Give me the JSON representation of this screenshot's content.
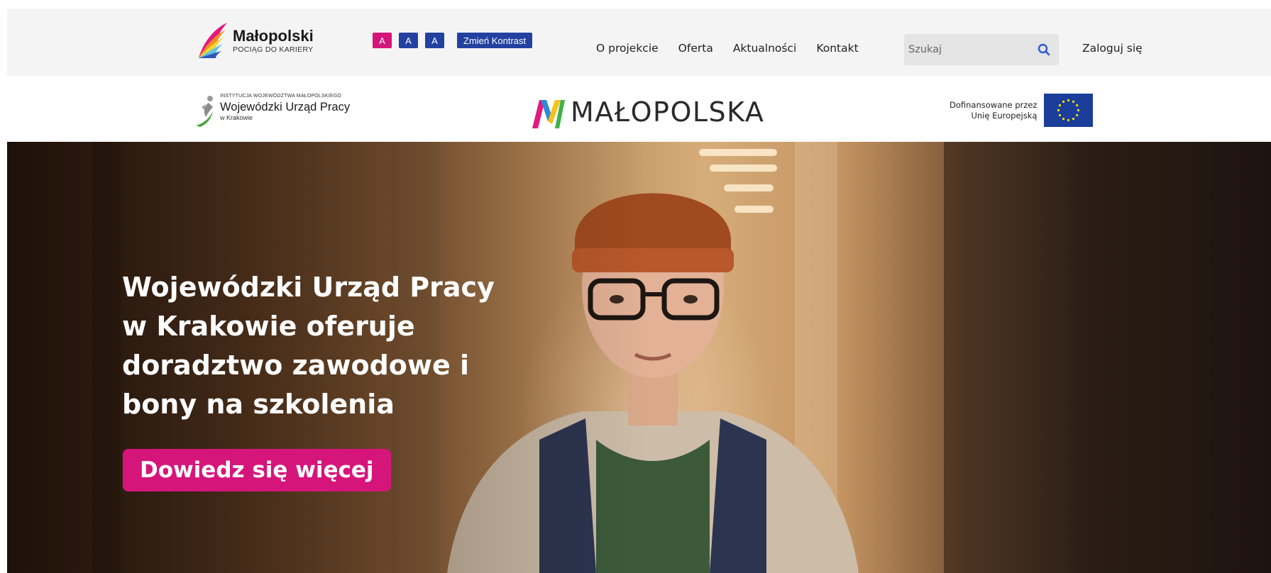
{
  "header": {
    "logo": {
      "title": "Małopolski",
      "subtitle": "POCIĄG DO KARIERY"
    },
    "font_size_buttons": [
      "A",
      "A",
      "A"
    ],
    "contrast_label": "Zmień Kontrast",
    "menu": [
      {
        "label": "O projekcie"
      },
      {
        "label": "Oferta"
      },
      {
        "label": "Aktualności"
      },
      {
        "label": "Kontakt"
      }
    ],
    "search": {
      "placeholder": "Szukaj",
      "icon": "search-icon"
    },
    "login_label": "Zaloguj się"
  },
  "partners": {
    "wup": {
      "small": "INSTYTUCJA WOJEWÓDZTWA MAŁOPOLSKIEGO",
      "title": "Wojewódzki Urząd Pracy",
      "city": "w Krakowie"
    },
    "malopolska": "MAŁOPOLSKA",
    "eu": {
      "line1": "Dofinansowane przez",
      "line2": "Unię Europejską"
    }
  },
  "hero": {
    "title": "Wojewódzki Urząd Pracy w Krakowie oferuje doradztwo zawodowe i bony na szkolenia",
    "cta_label": "Dowiedz się więcej"
  },
  "colors": {
    "accent_pink": "#d6157b",
    "accent_blue": "#2341a0",
    "eu_blue": "#1b3e9a",
    "nav_bg": "#f4f4f4"
  }
}
